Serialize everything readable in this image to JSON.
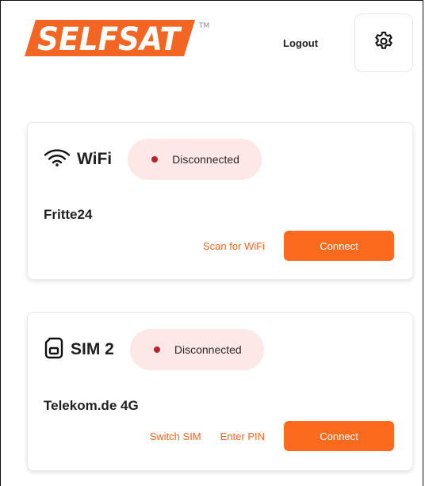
{
  "brand": {
    "logo_text": "SELFSAT",
    "trademark": "TM",
    "accent_color": "#fb6a1d"
  },
  "header": {
    "logout_label": "Logout",
    "settings_icon": "gear-icon"
  },
  "wifi": {
    "icon": "wifi-icon",
    "title": "WiFi",
    "status": "Disconnected",
    "status_color": "#b3262b",
    "network_name": "Fritte24",
    "scan_label": "Scan for WiFi",
    "connect_label": "Connect"
  },
  "sim": {
    "icon": "sim-card-icon",
    "title": "SIM 2",
    "status": "Disconnected",
    "status_color": "#b3262b",
    "network_name": "Telekom.de 4G",
    "switch_label": "Switch SIM",
    "pin_label": "Enter PIN",
    "connect_label": "Connect"
  }
}
